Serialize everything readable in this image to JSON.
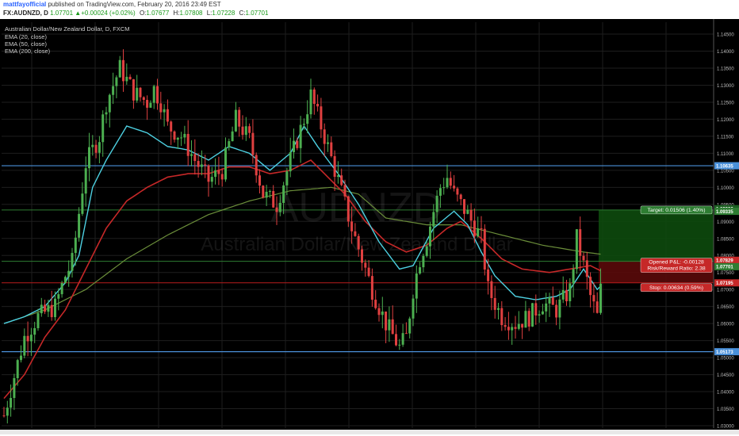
{
  "header": {
    "user": "mattfayofficial",
    "published": "published on TradingView.com, February 20, 2016 23:49 EST",
    "symbol": "FX:AUDNZD, D",
    "last": "1.07701",
    "change": "+0.00024 (+0.02%)",
    "o_label": "O:",
    "o": "1.07677",
    "h_label": "H:",
    "h": "1.07808",
    "l_label": "L:",
    "l": "1.07228",
    "c_label": "C:",
    "c": "1.07701"
  },
  "legend": {
    "title": "Australian Dollar/New Zealand Dollar, D, FXCM",
    "ema20": "EMA (20, close)",
    "ema50": "EMA (50, close)",
    "ema200": "EMA (200, close)"
  },
  "watermark": {
    "symbol": "AUDNZD",
    "name": "Australian Dollar/New Zealand Dollar"
  },
  "colors": {
    "background": "#000000",
    "up": "#4caf50",
    "down": "#e04040",
    "ema20": "#4dd0e1",
    "ema50": "#c62828",
    "ema200": "#6b8e3a",
    "hline": "#4a90d9",
    "target_zone": "#0d4a0d",
    "stop_zone": "#5a0a0a",
    "grid": "#1e1e1e"
  },
  "position": {
    "target_label": "Target: 0.01506 (1.40%)",
    "opened_pl": "Opened P&L: -0.00128",
    "risk_reward": "Risk/Reward Ratio: 2.38",
    "stop_label": "Stop: 0.00634 (0.59%)"
  },
  "chart_data": {
    "type": "candlestick",
    "ylim": [
      1.0293,
      1.1485
    ],
    "y_ticks": [
      "1.03000",
      "1.03500",
      "1.04000",
      "1.04500",
      "1.05000",
      "1.05500",
      "1.06000",
      "1.06500",
      "1.07000",
      "1.07500",
      "1.08000",
      "1.08500",
      "1.09000",
      "1.09500",
      "1.10000",
      "1.10500",
      "1.11000",
      "1.11500",
      "1.12000",
      "1.12500",
      "1.13000",
      "1.13500",
      "1.14000",
      "1.14500"
    ],
    "bars": 176,
    "hlines": [
      {
        "value": 1.10635,
        "label": "1.10635"
      },
      {
        "value": 1.05173,
        "label": "1.05173"
      }
    ],
    "position": {
      "entry": 1.07829,
      "target": 1.09335,
      "stop": 1.07195,
      "current": 1.07701,
      "entry_label": "1.07829",
      "target_label": "1.09335",
      "target_top_label": "1.09336",
      "current_label": "1.07701",
      "stop_label": "1.07195"
    },
    "price_anchors": [
      [
        0,
        1.033
      ],
      [
        6,
        1.056
      ],
      [
        10,
        1.062
      ],
      [
        15,
        1.065
      ],
      [
        18,
        1.074
      ],
      [
        20,
        1.078
      ],
      [
        24,
        1.107
      ],
      [
        28,
        1.115
      ],
      [
        30,
        1.125
      ],
      [
        34,
        1.135
      ],
      [
        38,
        1.128
      ],
      [
        42,
        1.125
      ],
      [
        44,
        1.129
      ],
      [
        46,
        1.125
      ],
      [
        48,
        1.118
      ],
      [
        52,
        1.115
      ],
      [
        56,
        1.108
      ],
      [
        60,
        1.102
      ],
      [
        64,
        1.105
      ],
      [
        68,
        1.12
      ],
      [
        72,
        1.114
      ],
      [
        76,
        1.098
      ],
      [
        80,
        1.095
      ],
      [
        84,
        1.108
      ],
      [
        88,
        1.12
      ],
      [
        90,
        1.127
      ],
      [
        94,
        1.115
      ],
      [
        98,
        1.102
      ],
      [
        100,
        1.095
      ],
      [
        102,
        1.088
      ],
      [
        104,
        1.082
      ],
      [
        108,
        1.07
      ],
      [
        112,
        1.06
      ],
      [
        116,
        1.053
      ],
      [
        118,
        1.056
      ],
      [
        120,
        1.07
      ],
      [
        122,
        1.079
      ],
      [
        124,
        1.085
      ],
      [
        126,
        1.093
      ],
      [
        128,
        1.1
      ],
      [
        130,
        1.103
      ],
      [
        132,
        1.098
      ],
      [
        134,
        1.095
      ],
      [
        136,
        1.092
      ],
      [
        140,
        1.085
      ],
      [
        142,
        1.07
      ],
      [
        146,
        1.062
      ],
      [
        150,
        1.06
      ],
      [
        154,
        1.062
      ],
      [
        158,
        1.066
      ],
      [
        162,
        1.064
      ],
      [
        166,
        1.07
      ],
      [
        168,
        1.085
      ],
      [
        170,
        1.077
      ],
      [
        172,
        1.068
      ],
      [
        174,
        1.062
      ],
      [
        176,
        1.078
      ],
      [
        178,
        1.08
      ],
      [
        179,
        1.077
      ]
    ],
    "ema_anchors": {
      "ema20": [
        [
          0,
          1.06
        ],
        [
          6,
          1.062
        ],
        [
          12,
          1.065
        ],
        [
          18,
          1.072
        ],
        [
          22,
          1.08
        ],
        [
          26,
          1.1
        ],
        [
          30,
          1.108
        ],
        [
          36,
          1.118
        ],
        [
          42,
          1.116
        ],
        [
          48,
          1.112
        ],
        [
          54,
          1.111
        ],
        [
          60,
          1.108
        ],
        [
          66,
          1.112
        ],
        [
          72,
          1.11
        ],
        [
          78,
          1.105
        ],
        [
          84,
          1.11
        ],
        [
          88,
          1.118
        ],
        [
          92,
          1.112
        ],
        [
          98,
          1.104
        ],
        [
          104,
          1.095
        ],
        [
          110,
          1.084
        ],
        [
          116,
          1.076
        ],
        [
          120,
          1.077
        ],
        [
          126,
          1.088
        ],
        [
          132,
          1.093
        ],
        [
          136,
          1.089
        ],
        [
          140,
          1.081
        ],
        [
          144,
          1.074
        ],
        [
          150,
          1.068
        ],
        [
          156,
          1.067
        ],
        [
          162,
          1.068
        ],
        [
          166,
          1.07
        ],
        [
          170,
          1.076
        ],
        [
          174,
          1.07
        ],
        [
          178,
          1.074
        ]
      ],
      "ema50": [
        [
          0,
          1.038
        ],
        [
          6,
          1.045
        ],
        [
          12,
          1.056
        ],
        [
          18,
          1.064
        ],
        [
          24,
          1.076
        ],
        [
          30,
          1.088
        ],
        [
          36,
          1.096
        ],
        [
          42,
          1.1
        ],
        [
          48,
          1.103
        ],
        [
          54,
          1.104
        ],
        [
          60,
          1.104
        ],
        [
          66,
          1.106
        ],
        [
          72,
          1.106
        ],
        [
          78,
          1.104
        ],
        [
          84,
          1.105
        ],
        [
          90,
          1.108
        ],
        [
          96,
          1.102
        ],
        [
          100,
          1.098
        ],
        [
          106,
          1.09
        ],
        [
          112,
          1.084
        ],
        [
          118,
          1.081
        ],
        [
          124,
          1.083
        ],
        [
          130,
          1.088
        ],
        [
          134,
          1.09
        ],
        [
          140,
          1.085
        ],
        [
          146,
          1.079
        ],
        [
          152,
          1.076
        ],
        [
          160,
          1.075
        ],
        [
          166,
          1.076
        ],
        [
          172,
          1.077
        ],
        [
          178,
          1.074
        ]
      ],
      "ema200": [
        [
          0,
          1.06
        ],
        [
          12,
          1.064
        ],
        [
          24,
          1.07
        ],
        [
          36,
          1.079
        ],
        [
          48,
          1.086
        ],
        [
          60,
          1.092
        ],
        [
          72,
          1.096
        ],
        [
          84,
          1.099
        ],
        [
          96,
          1.1
        ],
        [
          104,
          1.098
        ],
        [
          112,
          1.091
        ],
        [
          124,
          1.089
        ],
        [
          134,
          1.089
        ],
        [
          146,
          1.086
        ],
        [
          158,
          1.083
        ],
        [
          170,
          1.081
        ],
        [
          178,
          1.08
        ]
      ]
    }
  }
}
